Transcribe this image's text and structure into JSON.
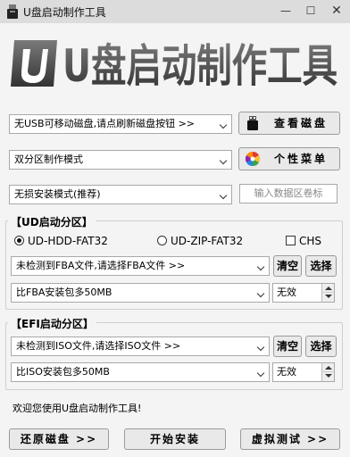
{
  "window": {
    "title": "U盘启动制作工具",
    "minimize_glyph": "—",
    "maximize_glyph": "☐",
    "close_glyph": "✕"
  },
  "banner": {
    "logo_text": "U盘启动制作工具",
    "icon": "usb-drive-logo-icon"
  },
  "device": {
    "combo_value": "无USB可移动磁盘,请点刷新磁盘按钮 >>",
    "view_button": "查看磁盘",
    "view_icon": "usb-drive-icon"
  },
  "mode": {
    "combo_value": "双分区制作模式",
    "menu_button": "个性菜单",
    "menu_icon": "color-wheel-icon"
  },
  "install": {
    "combo_value": "无损安装模式(推荐)",
    "label_placeholder": "输入数据区卷标"
  },
  "ud_group": {
    "title": "【UD启动分区】",
    "radio_fat32": "UD-HDD-FAT32",
    "radio_zip": "UD-ZIP-FAT32",
    "chs_label": "CHS",
    "file_combo": "未检测到FBA文件,请选择FBA文件 >>",
    "clear_button": "清空",
    "select_button": "选择",
    "size_combo": "比FBA安装包多50MB",
    "spin_value": "无效"
  },
  "efi_group": {
    "title": "【EFI启动分区】",
    "file_combo": "未检测到ISO文件,请选择ISO文件 >>",
    "clear_button": "清空",
    "select_button": "选择",
    "size_combo": "比ISO安装包多50MB",
    "spin_value": "无效"
  },
  "status_text": "欢迎您使用U盘启动制作工具!",
  "bottom": {
    "restore_button": "还原磁盘 >>",
    "start_button": "开始安装",
    "test_button": "虚拟测试 >>"
  },
  "colors": {
    "window_bg": "#f4f4f4",
    "titlebar": "#dcdcdc",
    "logo": "#555555"
  }
}
